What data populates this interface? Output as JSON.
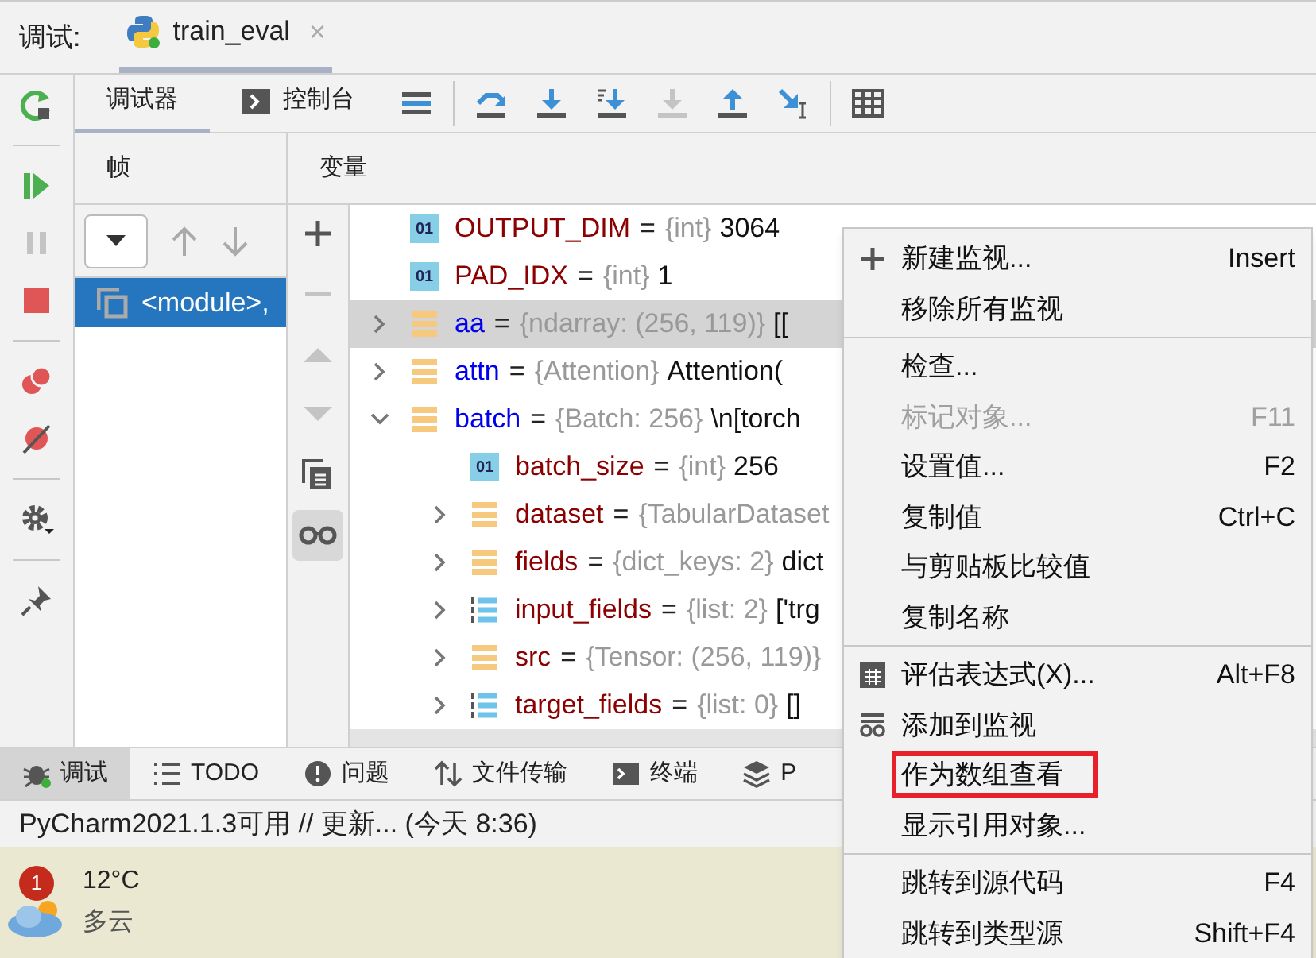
{
  "debug_label": "调试:",
  "session_tabs": [
    {
      "label": "train_eval",
      "selected": true,
      "close": "×"
    }
  ],
  "debugger_tabs": [
    {
      "label": "调试器",
      "kind": "debugger",
      "selected": true
    },
    {
      "label": "控制台",
      "kind": "console",
      "selected": false
    }
  ],
  "frames": {
    "title": "帧",
    "items": [
      {
        "label": "<module>,",
        "selected": true
      }
    ]
  },
  "variables": {
    "title": "变量",
    "rows": [
      {
        "kind": "int",
        "badge": "01",
        "name": "OUTPUT_DIM",
        "op": "=",
        "color": "#8b0000",
        "type": "{int}",
        "value": "3064",
        "selected": false
      },
      {
        "kind": "int",
        "badge": "01",
        "name": "PAD_IDX",
        "op": "=",
        "color": "#8b0000",
        "type": "{int}",
        "value": "1",
        "selected": false
      },
      {
        "kind": "object",
        "name": "aa",
        "op": "=",
        "color": "#0000ee",
        "type": "{ndarray: (256, 119)}",
        "value": "[[",
        "expanded": false,
        "selected": true
      },
      {
        "kind": "object",
        "name": "attn",
        "op": "=",
        "color": "#0000ee",
        "type": "{Attention}",
        "value": "Attention(",
        "expanded": false,
        "selected": false
      },
      {
        "kind": "object",
        "name": "batch",
        "op": "=",
        "color": "#0000ee",
        "type": "{Batch: 256}",
        "value": "\\n[torch",
        "expanded": true,
        "selected": false,
        "children": [
          {
            "kind": "int",
            "badge": "01",
            "name": "batch_size",
            "op": "=",
            "color": "#8b0000",
            "type": "{int}",
            "value": "256",
            "selected": false
          },
          {
            "kind": "object",
            "name": "dataset",
            "op": "=",
            "color": "#8b0000",
            "type": "{TabularDataset",
            "expanded": false,
            "selected": false
          },
          {
            "kind": "object",
            "name": "fields",
            "op": "=",
            "color": "#8b0000",
            "type": "{dict_keys: 2}",
            "value": "dict",
            "expanded": false,
            "selected": false
          },
          {
            "kind": "list",
            "name": "input_fields",
            "op": "=",
            "color": "#8b0000",
            "type": "{list: 2}",
            "value": "['trg",
            "expanded": false,
            "selected": false
          },
          {
            "kind": "object",
            "name": "src",
            "op": "=",
            "color": "#8b0000",
            "type": "{Tensor: (256, 119)}",
            "expanded": false,
            "selected": false
          },
          {
            "kind": "list",
            "name": "target_fields",
            "op": "=",
            "color": "#8b0000",
            "type": "{list: 0}",
            "value": "[]",
            "expanded": false,
            "selected": false
          }
        ]
      }
    ]
  },
  "context_menu": [
    {
      "kind": "item",
      "label": "新建监视...",
      "shortcut": "Insert",
      "disabled": false,
      "highlighted": false
    },
    {
      "kind": "item",
      "label": "移除所有监视",
      "disabled": false,
      "highlighted": false
    },
    {
      "kind": "separator"
    },
    {
      "kind": "item",
      "label": "检查...",
      "disabled": false,
      "highlighted": false
    },
    {
      "kind": "item",
      "label": "标记对象...",
      "shortcut": "F11",
      "disabled": true,
      "highlighted": false
    },
    {
      "kind": "item",
      "label": "设置值...",
      "shortcut": "F2",
      "disabled": false,
      "highlighted": false
    },
    {
      "kind": "item",
      "label": "复制值",
      "shortcut": "Ctrl+C",
      "disabled": false,
      "highlighted": false
    },
    {
      "kind": "item",
      "label": "与剪贴板比较值",
      "disabled": false,
      "highlighted": false
    },
    {
      "kind": "item",
      "label": "复制名称",
      "disabled": false,
      "highlighted": false
    },
    {
      "kind": "separator"
    },
    {
      "kind": "item",
      "label": "评估表达式(X)...",
      "shortcut": "Alt+F8",
      "disabled": false,
      "highlighted": false
    },
    {
      "kind": "item",
      "label": "添加到监视",
      "disabled": false,
      "highlighted": false
    },
    {
      "kind": "item",
      "label": "作为数组查看",
      "disabled": false,
      "highlighted": true
    },
    {
      "kind": "item",
      "label": "显示引用对象...",
      "disabled": false,
      "highlighted": false
    },
    {
      "kind": "separator"
    },
    {
      "kind": "item",
      "label": "跳转到源代码",
      "shortcut": "F4",
      "disabled": false,
      "highlighted": false
    },
    {
      "kind": "item",
      "label": "跳转到类型源",
      "shortcut": "Shift+F4",
      "disabled": false,
      "highlighted": false
    }
  ],
  "tool_tabs": [
    {
      "label": "调试",
      "selected": true
    },
    {
      "label": "TODO",
      "selected": false
    },
    {
      "label": "问题",
      "selected": false
    },
    {
      "label": "文件传输",
      "selected": false
    },
    {
      "label": "终端",
      "selected": false
    },
    {
      "label": "P",
      "selected": false
    }
  ],
  "status_bar": "PyCharm2021.1.3可用 // 更新... (今天 8:36)",
  "weather": {
    "badge": "1",
    "temperature": "12°C",
    "condition": "多云"
  }
}
